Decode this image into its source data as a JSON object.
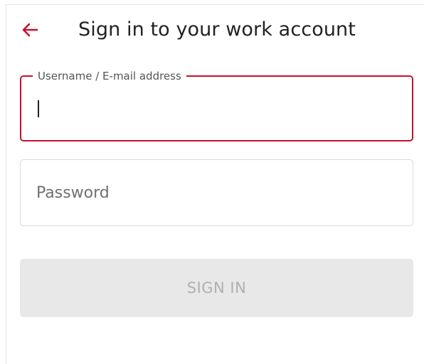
{
  "header": {
    "back_icon": "arrow-left-icon",
    "title": "Sign in to your work account"
  },
  "form": {
    "username": {
      "label": "Username / E-mail address",
      "value": "",
      "placeholder": ""
    },
    "password": {
      "value": "",
      "placeholder": "Password"
    },
    "submit_label": "SIGN IN"
  },
  "colors": {
    "accent": "#c8102e",
    "disabled_button_bg": "#e8e8e8",
    "disabled_button_text": "#b0b0b0"
  }
}
